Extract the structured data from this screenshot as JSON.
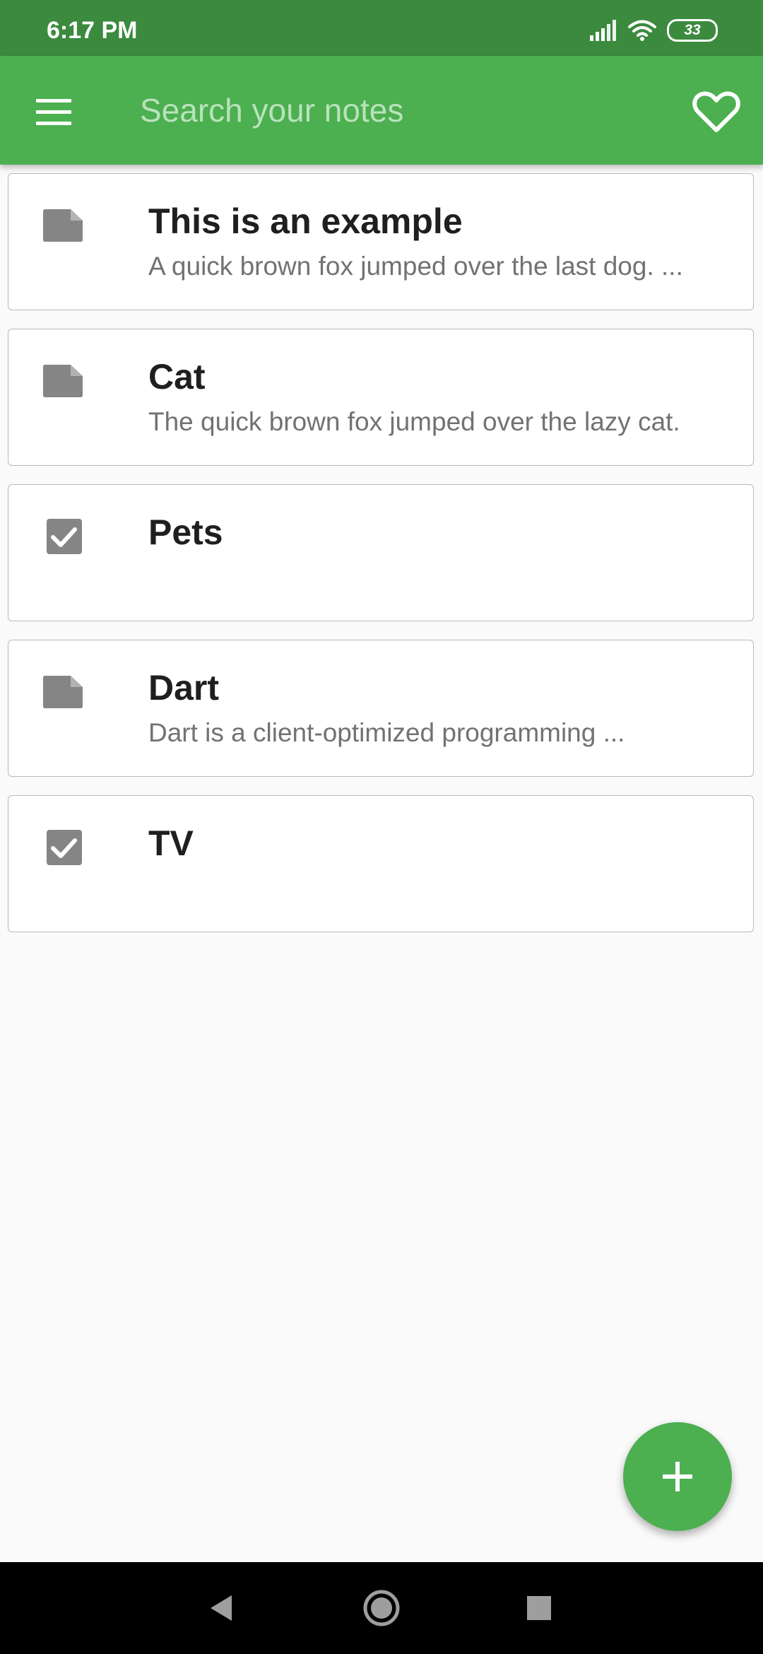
{
  "status_bar": {
    "time": "6:17 PM",
    "battery": "33",
    "icons": [
      "signal-icon",
      "wifi-icon",
      "battery-icon"
    ]
  },
  "app_bar": {
    "search_placeholder": "Search your notes",
    "menu_icon": "menu-icon",
    "favorite_icon": "heart-icon"
  },
  "notes": [
    {
      "title": "This is an example",
      "preview": "A quick brown fox jumped over the last dog. ...",
      "icon": "note-icon"
    },
    {
      "title": "Cat",
      "preview": "The quick brown fox jumped over the lazy cat.",
      "icon": "note-icon"
    },
    {
      "title": "Pets",
      "preview": "",
      "icon": "checkbox-icon"
    },
    {
      "title": "Dart",
      "preview": "Dart is a client-optimized programming ...",
      "icon": "note-icon"
    },
    {
      "title": "TV",
      "preview": "",
      "icon": "checkbox-icon"
    }
  ],
  "fab": {
    "icon": "plus-icon"
  },
  "colors": {
    "status_bar": "#3b8a3e",
    "app_bar": "#4caf50",
    "accent": "#4caf50",
    "icon_gray": "#858585"
  }
}
